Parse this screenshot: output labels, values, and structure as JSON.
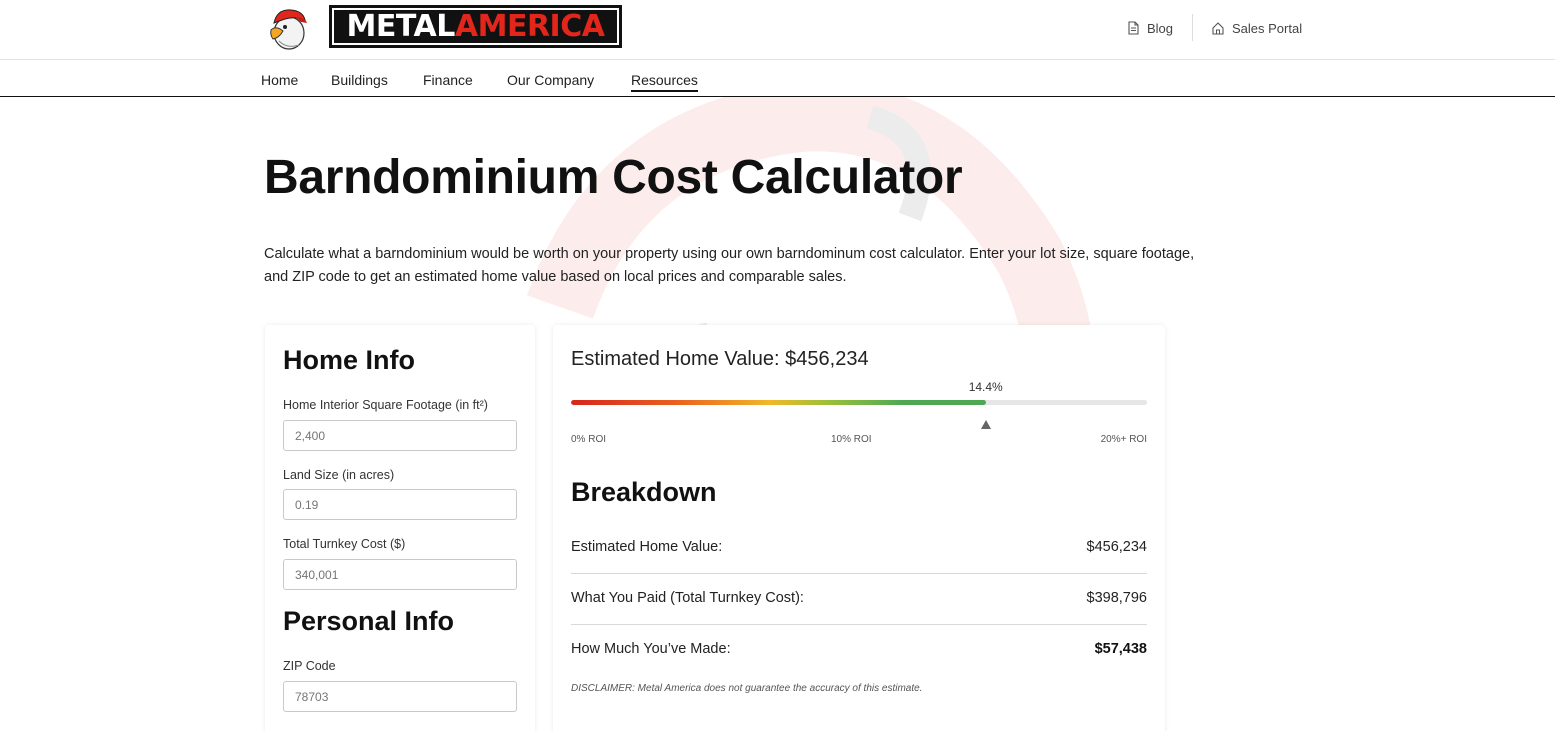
{
  "header": {
    "brand": {
      "name_part1": "METAL",
      "name_part2": "AMERICA"
    },
    "util_links": [
      {
        "label": "Blog",
        "icon": "document-icon"
      },
      {
        "label": "Sales Portal",
        "icon": "house-icon"
      }
    ]
  },
  "nav": {
    "items": [
      {
        "label": "Home"
      },
      {
        "label": "Buildings"
      },
      {
        "label": "Finance"
      },
      {
        "label": "Our Company"
      },
      {
        "label": "Resources",
        "active": true
      }
    ]
  },
  "page": {
    "title": "Barndominium Cost Calculator",
    "intro": "Calculate what a barndominium would be worth on your property using our own barndominum cost calculator. Enter your lot size, square footage, and ZIP code to get an estimated home value based on local prices and comparable sales."
  },
  "home_info": {
    "heading": "Home Info",
    "fields": [
      {
        "label": "Home Interior Square Footage (in ft²)",
        "placeholder": "2,400"
      },
      {
        "label": "Land Size (in acres)",
        "placeholder": "0.19"
      },
      {
        "label": "Total Turnkey Cost ($)",
        "placeholder": "340,001"
      }
    ]
  },
  "personal_info": {
    "heading": "Personal Info",
    "fields": [
      {
        "label": "ZIP Code",
        "placeholder": "78703"
      }
    ]
  },
  "results": {
    "estimate_title": "Estimated Home Value: $456,234",
    "roi_percent_label": "14.4%",
    "roi_percent": 14.4,
    "roi_max": 20,
    "roi_scale": [
      "0% ROI",
      "10% ROI",
      "20%+ ROI"
    ],
    "breakdown_heading": "Breakdown",
    "rows": [
      {
        "label": "Estimated Home Value:",
        "value": "$456,234"
      },
      {
        "label": "What You Paid (Total Turnkey Cost):",
        "value": "$398,796"
      },
      {
        "label": "How Much You’ve Made:",
        "value": "$57,438"
      }
    ],
    "disclaimer": "DISCLAIMER: Metal America does not guarantee the accuracy of this estimate."
  },
  "colors": {
    "brand_red": "#e3261c",
    "text_dark": "#111111",
    "roi_green": "#4ea853"
  }
}
